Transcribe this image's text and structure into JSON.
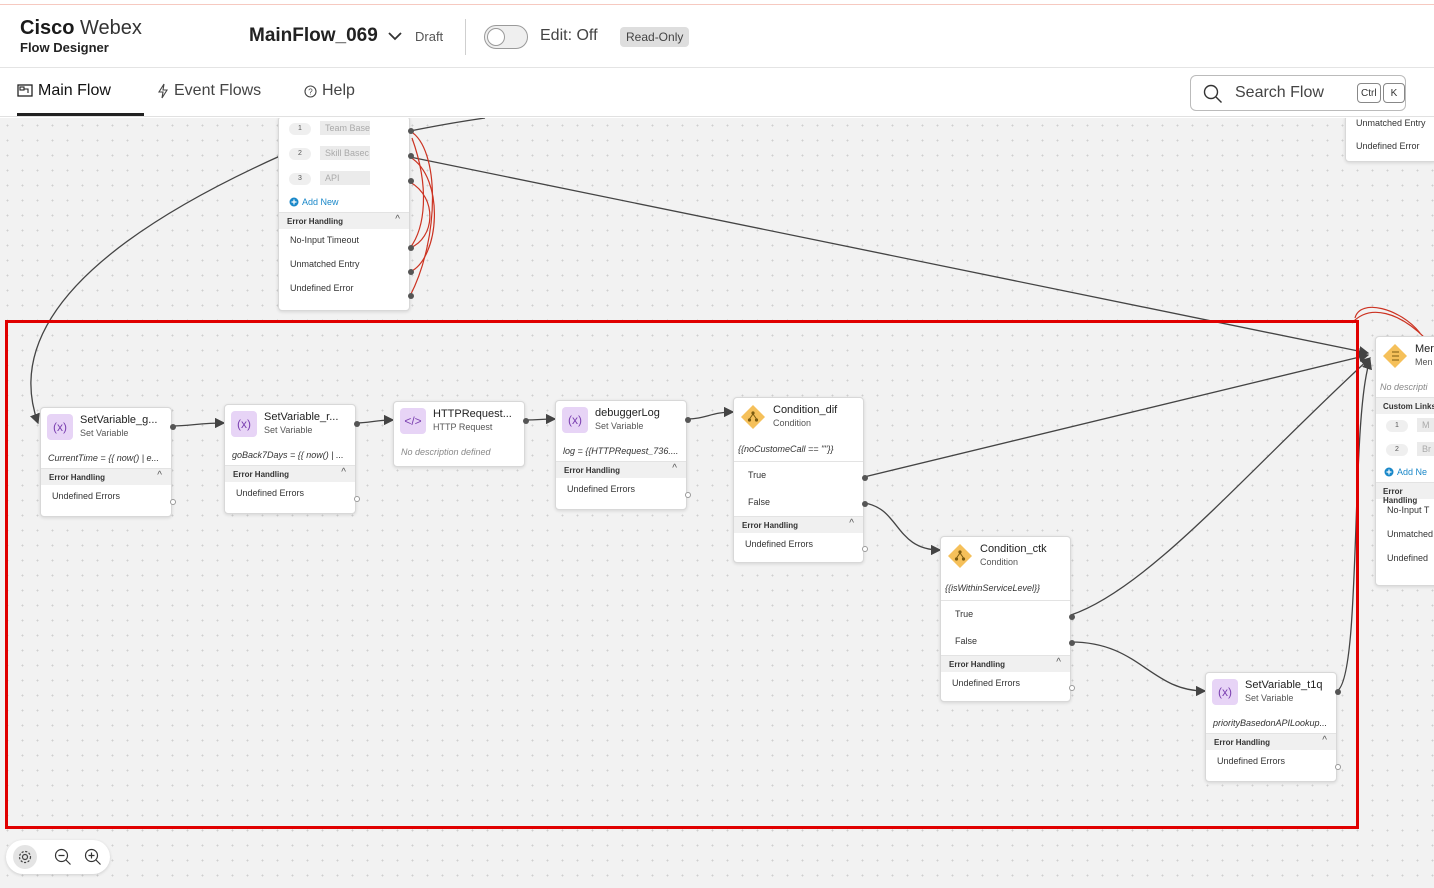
{
  "header": {
    "brand_name_bold": "Cisco",
    "brand_name_light": "Webex",
    "brand_sub": "Flow Designer",
    "flow_name": "MainFlow_069",
    "status": "Draft",
    "edit_label": "Edit: Off",
    "read_only_badge": "Read-Only"
  },
  "tabs": [
    {
      "label": "Main Flow",
      "icon": "flow-icon",
      "active": true
    },
    {
      "label": "Event Flows",
      "icon": "bolt-icon",
      "active": false
    },
    {
      "label": "Help",
      "icon": "question-icon",
      "active": false
    }
  ],
  "search": {
    "label": "Search Flow",
    "shortcut_1": "Ctrl",
    "shortcut_2": "K"
  },
  "top_node": {
    "links": [
      {
        "num": "1",
        "value": "Team Base"
      },
      {
        "num": "2",
        "value": "Skill Basec"
      },
      {
        "num": "3",
        "value": "API"
      }
    ],
    "add_new": "Add New",
    "error_handling": "Error Handling",
    "errors": [
      "No-Input Timeout",
      "Unmatched Entry",
      "Undefined Error"
    ]
  },
  "top_right_node": {
    "errors": [
      "Unmatched Entry",
      "Undefined Error"
    ]
  },
  "nodes": {
    "sv_g": {
      "title": "SetVariable_g...",
      "type": "Set Variable",
      "desc": "CurrentTime = {{ now() | e...",
      "eh": "Error Handling",
      "err": "Undefined Errors"
    },
    "sv_r": {
      "title": "SetVariable_r...",
      "type": "Set Variable",
      "desc": "goBack7Days = {{ now() | ...",
      "eh": "Error Handling",
      "err": "Undefined Errors"
    },
    "http": {
      "title": "HTTPRequest...",
      "type": "HTTP Request",
      "desc": "No description defined"
    },
    "dbg": {
      "title": "debuggerLog",
      "type": "Set Variable",
      "desc": "log = {{HTTPRequest_736....",
      "eh": "Error Handling",
      "err": "Undefined Errors"
    },
    "cond_dif": {
      "title": "Condition_dif",
      "type": "Condition",
      "desc": "{{noCustomeCall == \"\"}}",
      "true": "True",
      "false": "False",
      "eh": "Error Handling",
      "err": "Undefined Errors"
    },
    "cond_ctk": {
      "title": "Condition_ctk",
      "type": "Condition",
      "desc": "{{isWithinServiceLevel}}",
      "true": "True",
      "false": "False",
      "eh": "Error Handling",
      "err": "Undefined Errors"
    },
    "sv_t1q": {
      "title": "SetVariable_t1q",
      "type": "Set Variable",
      "desc": "priorityBasedonAPILookup...",
      "eh": "Error Handling",
      "err": "Undefined Errors"
    }
  },
  "menu_node": {
    "title": "Mer",
    "type": "Men",
    "desc": "No descripti",
    "custom_links": "Custom Links",
    "links": [
      {
        "num": "1",
        "value": "M"
      },
      {
        "num": "2",
        "value": "Br"
      }
    ],
    "add_new": "Add Ne",
    "eh": "Error Handling",
    "errors": [
      "No-Input T",
      "Unmatched",
      "Undefined"
    ]
  },
  "colors": {
    "accent_red": "#e00000",
    "set_variable": "#e7d4f6",
    "condition": "#f5c05a",
    "http": "#e7d4f6",
    "link": "#1a88c9"
  }
}
